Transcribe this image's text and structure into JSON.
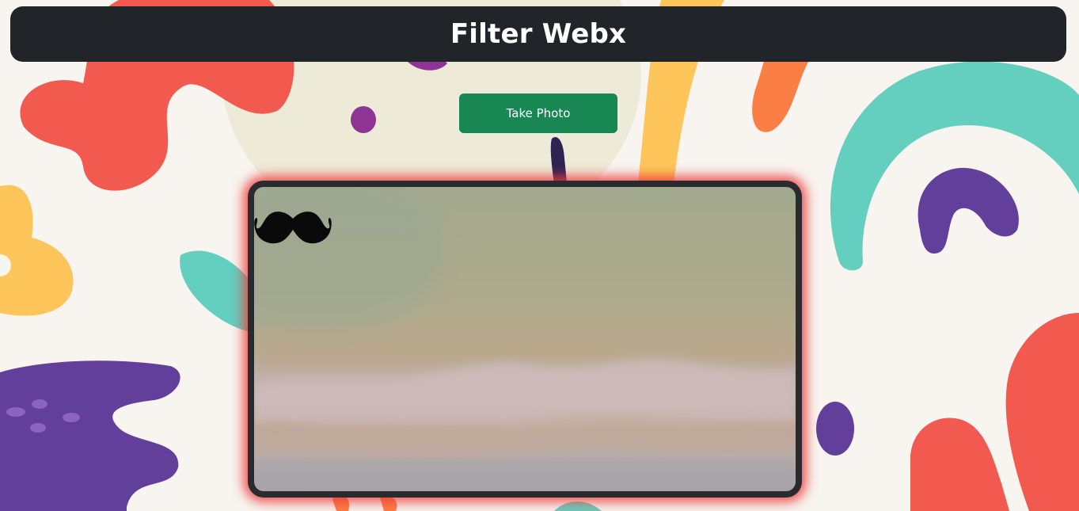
{
  "header": {
    "title": "Filter Webx"
  },
  "controls": {
    "take_photo_label": "Take Photo"
  },
  "camera": {
    "overlay_filter": "mustache-icon"
  },
  "colors": {
    "header_bg": "#212429",
    "button_bg": "#198754",
    "frame_glow": "#eb3c3c",
    "page_bg": "#f8f4ef"
  }
}
